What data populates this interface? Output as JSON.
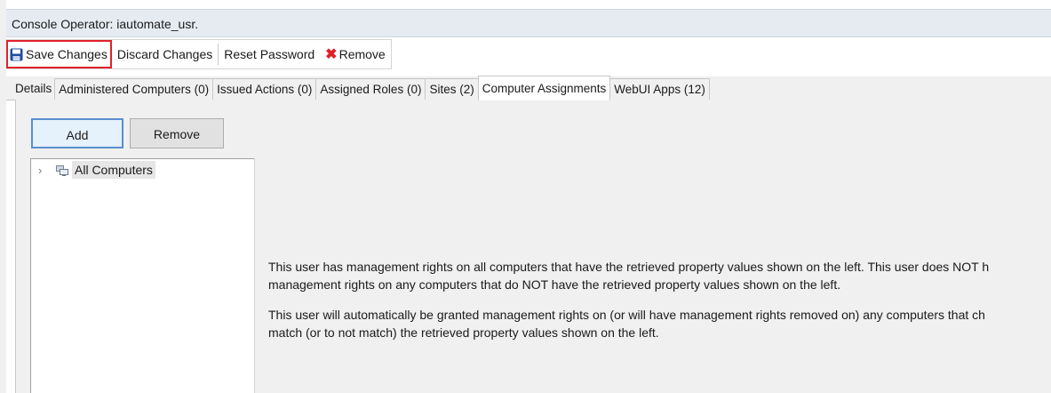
{
  "window": {
    "title": "Console Operator: iautomate_usr."
  },
  "toolbar": {
    "save": "Save Changes",
    "discard": "Discard Changes",
    "reset_password": "Reset Password",
    "remove": "Remove"
  },
  "tabs": [
    "Details",
    "Administered Computers (0)",
    "Issued Actions (0)",
    "Assigned Roles (0)",
    "Sites (2)",
    "Computer Assignments",
    "WebUI Apps (12)"
  ],
  "active_tab": "Computer Assignments",
  "panel": {
    "add_label": "Add",
    "remove_label": "Remove",
    "tree": {
      "root_label": "All Computers"
    },
    "info": {
      "line1": "This user has management rights on all computers that have the retrieved property values shown on the left. This user does NOT h",
      "line2": "management rights on any computers that do NOT have the retrieved property values shown on the left.",
      "line3": "This user will automatically be granted management rights on (or will have management rights removed on) any computers that ch",
      "line4": "match (or to not match) the retrieved property values shown on the left."
    }
  },
  "colors": {
    "highlight": "#e0202a",
    "accent": "#5a8ed0",
    "save_icon": "#1f4e9c"
  }
}
